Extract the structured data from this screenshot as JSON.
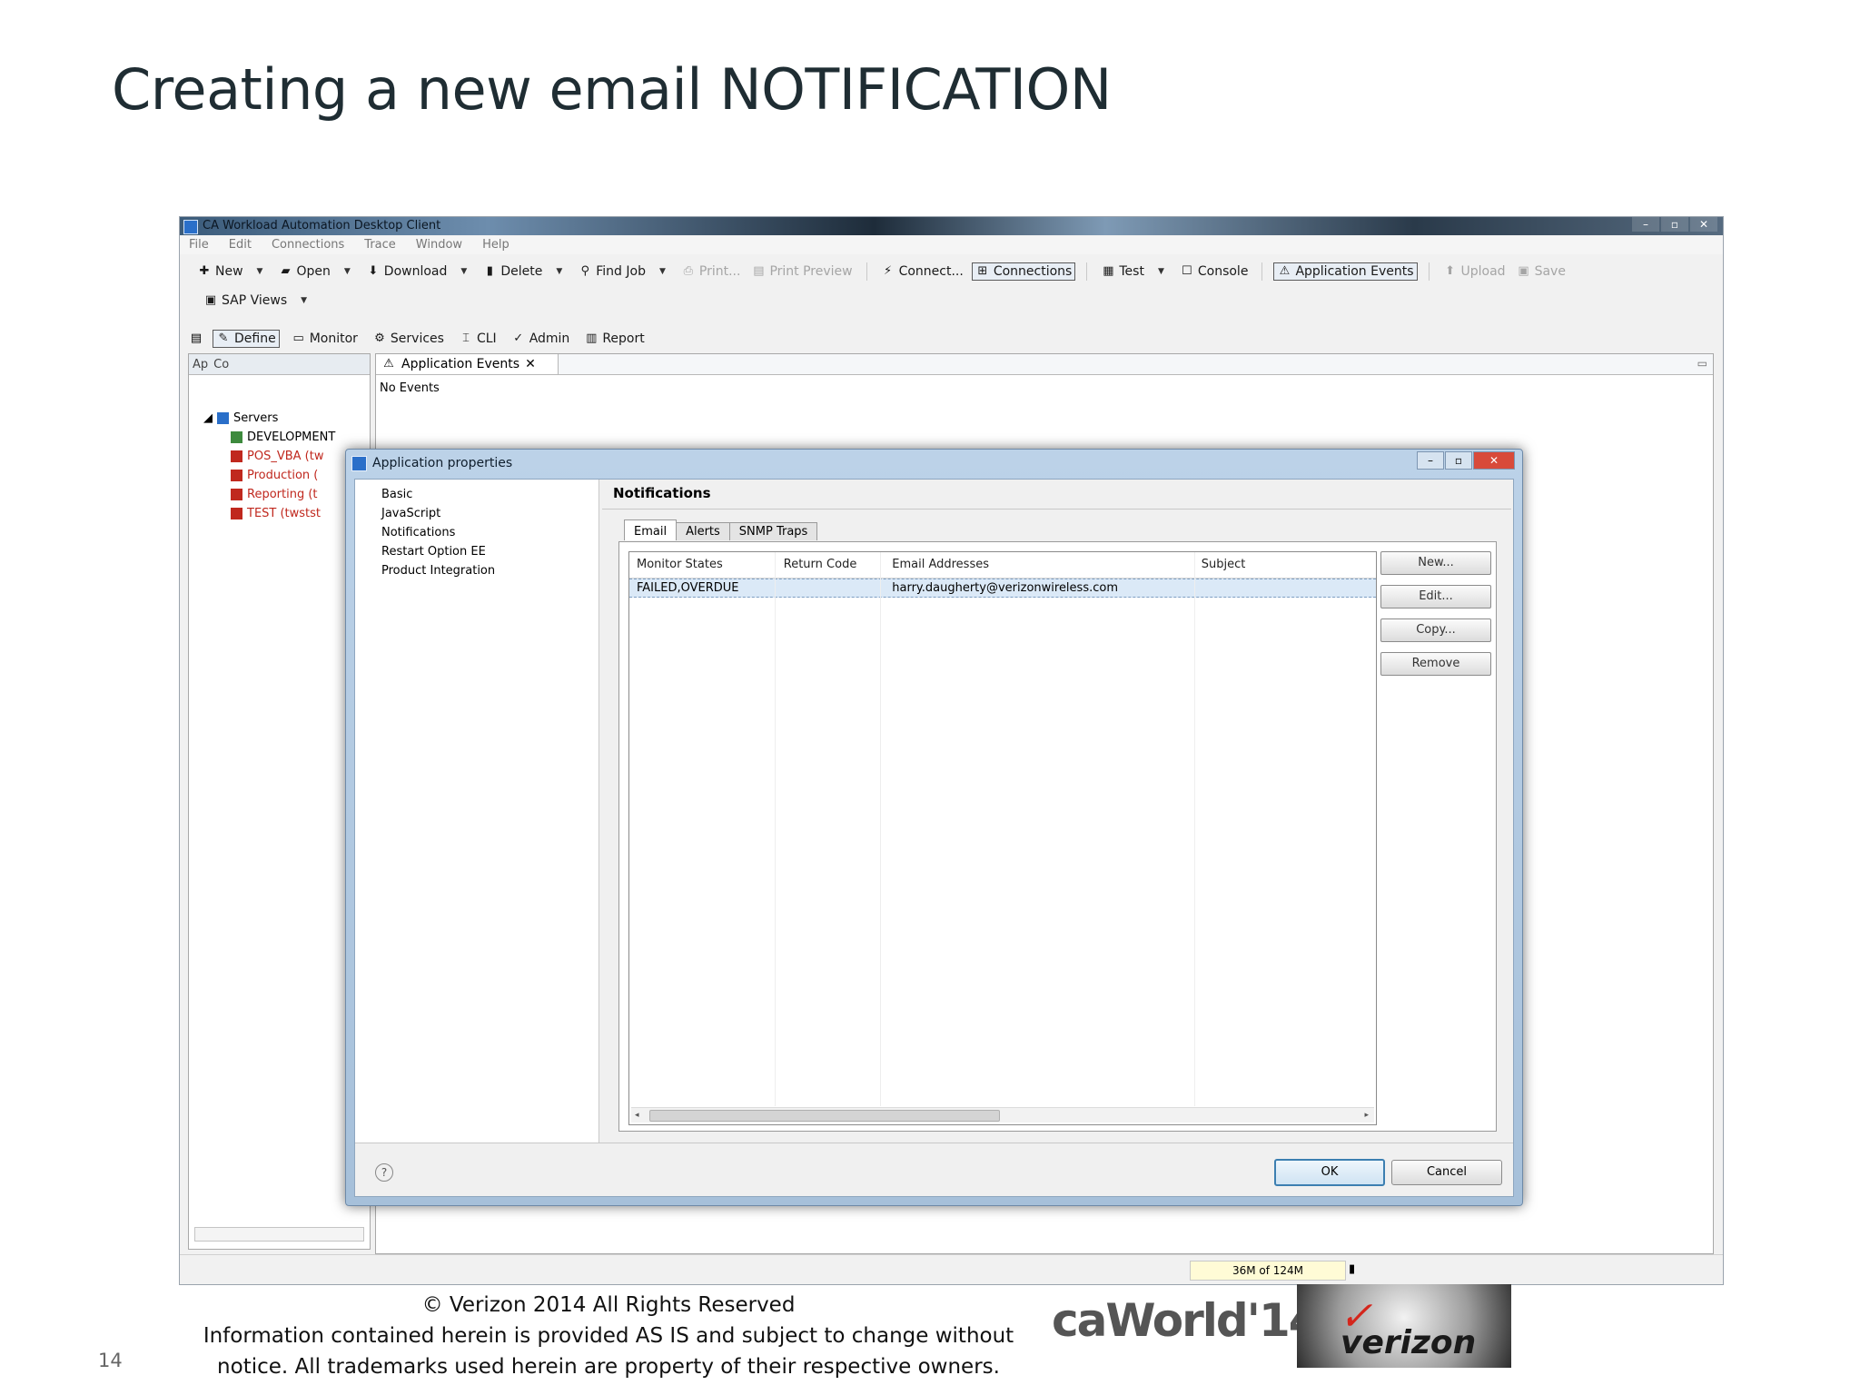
{
  "slide": {
    "title": "Creating a new email NOTIFICATION",
    "page_number": "14"
  },
  "app": {
    "title": "CA Workload Automation Desktop Client",
    "window_buttons": [
      "–",
      "▫",
      "✕"
    ],
    "menu": [
      "File",
      "Edit",
      "Connections",
      "Trace",
      "Window",
      "Help"
    ],
    "toolbar": {
      "new": "New",
      "open": "Open",
      "download": "Download",
      "delete": "Delete",
      "find_job": "Find Job",
      "print": "Print...",
      "print_preview": "Print Preview",
      "connect": "Connect...",
      "connections": "Connections",
      "test": "Test",
      "console": "Console",
      "application_events": "Application Events",
      "upload": "Upload",
      "save": "Save",
      "sap_views": "SAP Views"
    },
    "perspectives": [
      "Define",
      "Monitor",
      "Services",
      "CLI",
      "Admin",
      "Report"
    ],
    "left_panel": {
      "tabs": [
        "Ap",
        "Co"
      ],
      "tree_root": "Servers",
      "servers": [
        {
          "label": "DEVELOPMENT",
          "status": "ok"
        },
        {
          "label": "POS_VBA (tw",
          "status": "error"
        },
        {
          "label": "Production (",
          "status": "error"
        },
        {
          "label": "Reporting (t",
          "status": "error"
        },
        {
          "label": "TEST (twstst",
          "status": "error"
        }
      ]
    },
    "editor": {
      "tab": "Application Events",
      "content": "No Events"
    },
    "status": {
      "heap": "36M of 124M"
    }
  },
  "dialog": {
    "title": "Application properties",
    "nav": [
      "Basic",
      "JavaScript",
      "Notifications",
      "Restart Option EE",
      "Product Integration"
    ],
    "page_title": "Notifications",
    "tabs": [
      "Email",
      "Alerts",
      "SNMP Traps"
    ],
    "active_tab": "Email",
    "table": {
      "columns": [
        "Monitor States",
        "Return Code",
        "Email Addresses",
        "Subject"
      ],
      "rows": [
        [
          "FAILED,OVERDUE",
          "",
          "harry.daugherty@verizonwireless.com",
          ""
        ]
      ]
    },
    "side_buttons": [
      "New...",
      "Edit...",
      "Copy...",
      "Remove"
    ],
    "ok": "OK",
    "cancel": "Cancel",
    "help": "?"
  },
  "footer": {
    "line1": "© Verizon 2014 All Rights Reserved",
    "line2": "Information contained herein is provided AS IS and subject to change without",
    "line3": "notice.  All trademarks used herein are property of their respective owners.",
    "caworld_logo": "caWorld'14",
    "verizon_logo": "verizon"
  }
}
